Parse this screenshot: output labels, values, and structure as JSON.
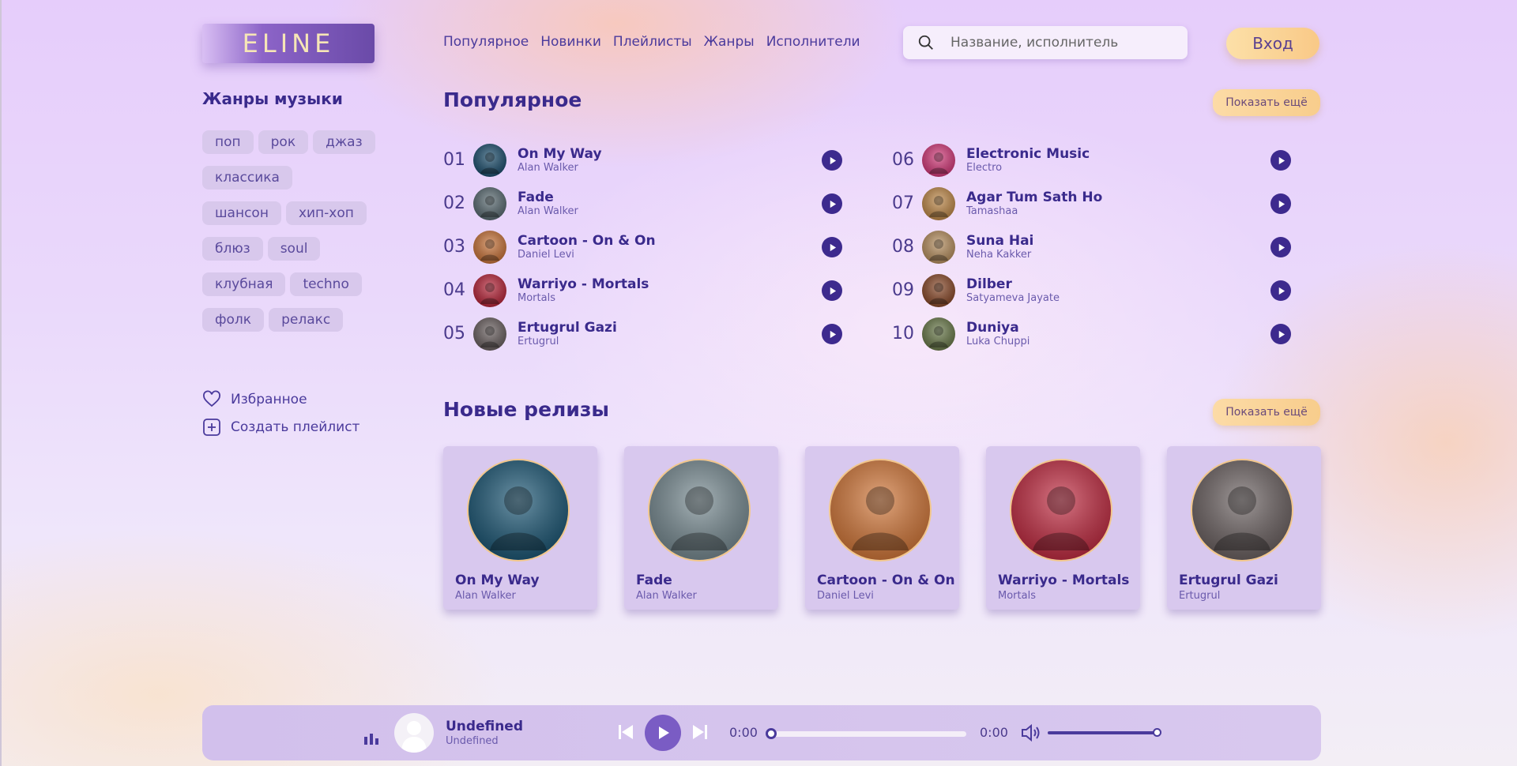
{
  "header": {
    "logo": "ELINE",
    "nav": [
      "Популярное",
      "Новинки",
      "Плейлисты",
      "Жанры",
      "Исполнители"
    ],
    "search_placeholder": "Название, исполнитель",
    "login_label": "Вход"
  },
  "sidebar": {
    "genres_title": "Жанры музыки",
    "genre_rows": [
      [
        "поп",
        "рок",
        "джаз"
      ],
      [
        "классика"
      ],
      [
        "шансон",
        "хип-хоп"
      ],
      [
        "блюз",
        "soul"
      ],
      [
        "клубная",
        "techno"
      ],
      [
        "фолк",
        "релакс"
      ]
    ],
    "favorites": "Избранное",
    "create_playlist": "Создать плейлист"
  },
  "popular": {
    "title": "Популярное",
    "more_label": "Показать ещё",
    "tracks": [
      {
        "num": "01",
        "title": "On My Way",
        "artist": "Alan Walker",
        "color": "#1d4f6e"
      },
      {
        "num": "02",
        "title": "Fade",
        "artist": "Alan Walker",
        "color": "#5a6b72"
      },
      {
        "num": "03",
        "title": "Cartoon - On & On",
        "artist": "Daniel Levi",
        "color": "#c9743a"
      },
      {
        "num": "04",
        "title": "Warriyo - Mortals",
        "artist": "Mortals",
        "color": "#b8263a"
      },
      {
        "num": "05",
        "title": "Ertugrul Gazi",
        "artist": "Ertugrul",
        "color": "#6a6060"
      },
      {
        "num": "06",
        "title": "Electronic Music",
        "artist": "Electro",
        "color": "#d43a7a"
      },
      {
        "num": "07",
        "title": "Agar Tum Sath Ho",
        "artist": "Tamashaa",
        "color": "#c08a4a"
      },
      {
        "num": "08",
        "title": "Suna Hai",
        "artist": "Neha Kakker",
        "color": "#b89060"
      },
      {
        "num": "09",
        "title": "Dilber",
        "artist": "Satyameva Jayate",
        "color": "#8a4a2a"
      },
      {
        "num": "10",
        "title": "Duniya",
        "artist": "Luka Chuppi",
        "color": "#6a7a4a"
      }
    ]
  },
  "new_releases": {
    "title": "Новые релизы",
    "more_label": "Показать ещё",
    "items": [
      {
        "title": "On My Way",
        "artist": "Alan Walker",
        "color": "#1f5a78"
      },
      {
        "title": "Fade",
        "artist": "Alan Walker",
        "color": "#7a8d94"
      },
      {
        "title": "Cartoon - On & On",
        "artist": "Daniel Levi",
        "color": "#d57a3c"
      },
      {
        "title": "Warriyo - Mortals",
        "artist": "Mortals",
        "color": "#c42e44"
      },
      {
        "title": "Ertugrul Gazi",
        "artist": "Ertugrul",
        "color": "#6e6464"
      }
    ]
  },
  "player": {
    "title": "Undefined",
    "artist": "Undefined",
    "time_current": "0:00",
    "time_total": "0:00",
    "progress": 0,
    "volume": 1
  }
}
